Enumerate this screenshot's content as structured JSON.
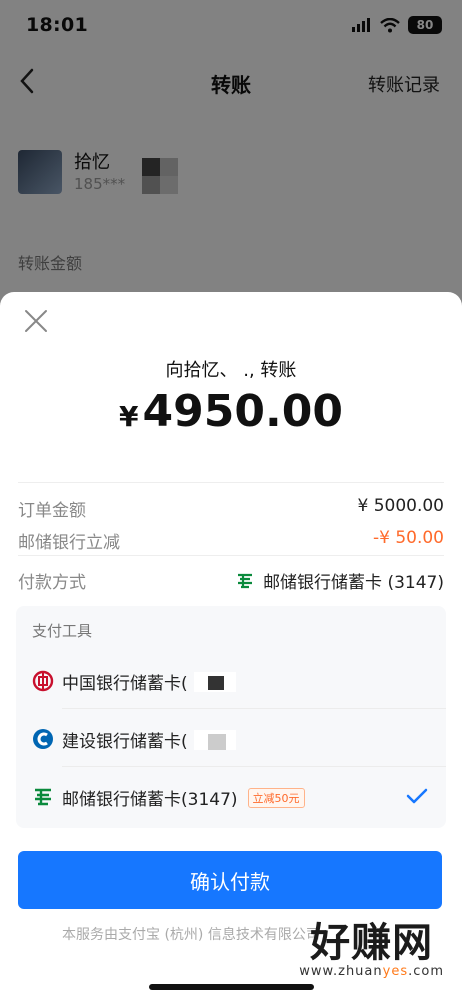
{
  "status": {
    "time": "18:01",
    "battery": "80"
  },
  "nav": {
    "title": "转账",
    "record": "转账记录"
  },
  "payee": {
    "name": "拾忆",
    "phone": "185***"
  },
  "transfer_amount_label": "转账金额",
  "sheet": {
    "pay_to": "向拾忆、   ., 转账",
    "amount_symbol": "¥",
    "amount": "4950.00",
    "order_label": "订单金额",
    "order_value": "¥ 5000.00",
    "discount_label": "邮储银行立减",
    "discount_value": "-¥ 50.00",
    "method_label": "付款方式",
    "method_value": "邮储银行储蓄卡 (3147)",
    "tools_title": "支付工具",
    "tools": [
      {
        "name": "中国银行储蓄卡(",
        "icon": "boc-icon"
      },
      {
        "name": "建设银行储蓄卡(",
        "icon": "ccb-icon"
      },
      {
        "name": "邮储银行储蓄卡(3147)",
        "icon": "psbc-icon",
        "tag": "立减50元",
        "selected": true
      }
    ],
    "confirm": "确认付款",
    "footer": "本服务由支付宝 (杭州) 信息技术有限公司"
  },
  "watermark": {
    "main": "好赚网",
    "sub_pre": "www.zhuan",
    "sub_hl": "yes",
    "sub_post": ".com"
  },
  "colors": {
    "primary": "#1677ff",
    "discount": "#ff6a2b",
    "psbc_green": "#0a8a3c",
    "boc_red": "#c8102e",
    "ccb_blue": "#0066b3"
  }
}
